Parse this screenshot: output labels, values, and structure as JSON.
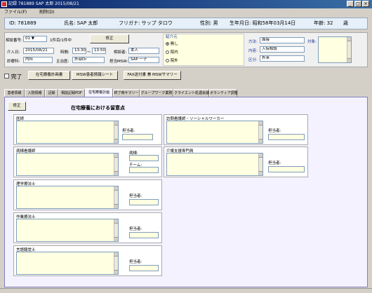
{
  "window": {
    "title": "記録 781889 SAP 太郎 2015/08/21"
  },
  "menu": {
    "items": [
      "ファイル(F)",
      "削除(D)"
    ]
  },
  "patient": {
    "id_text": "ID: 781889",
    "name_text": "氏名: SAP 太郎",
    "kana_text": "フリガナ: サップ タロウ",
    "sex_text": "性別: 男",
    "birth_text": "生年月日: 昭和58年03月14日",
    "age_text": "年齢: 32",
    "age_unit": "歳"
  },
  "form": {
    "count_label": "相談番号:",
    "count_value": "01",
    "count_suffix": "1件目/1件中",
    "edit_label": "修正",
    "admit_label": "介入日:",
    "admit_value": "2015/08/21",
    "time_label": "時間:",
    "time_from": "13:30",
    "time_sep": "～",
    "time_to": "13:50",
    "consultant_label": "相談者:",
    "consultant_value": "本人",
    "doctor_label": "診療科:",
    "doctor_value": "内科",
    "main_doc_label": "主治医:",
    "main_doc_value": "外部Dr",
    "msw_label": "担当MSW:",
    "msw_value": "SAP 一子",
    "referral_label": "紹介元",
    "referral_options": [
      "無し",
      "院内",
      "院外"
    ],
    "method_label": "方法:",
    "method_value": "面接",
    "content_label": "内容:",
    "content_value": "入院相談",
    "category_label": "区分:",
    "category_value": "外来",
    "target_label": "対象:"
  },
  "actions": {
    "complete_label": "完了",
    "btn_plan": "在宅療養計画書",
    "btn_msw_info": "MSW患者情報シート",
    "btn_fax": "FAX送付書 兼 MSWサマリー"
  },
  "tabs": [
    "患者情報",
    "入院情報",
    "記録",
    "相談記録PDF",
    "在宅療養計画",
    "終了時サマリー",
    "グループワーク業務",
    "クライエント処遇会議",
    "ボランティア調整"
  ],
  "panel": {
    "edit_label": "修正",
    "heading": "在宅療養における留意点",
    "staff_label": "担当者:",
    "nurse_staff_label": "病棟:",
    "team_label": "チーム:",
    "sections": {
      "doctor": "医師",
      "ward_nurse": "病棟看護師",
      "pt": "理学療法士",
      "ot": "作業療法士",
      "st": "言語聴覚士",
      "visit_nurse": "訪問看護師・ソーシャルワーカー",
      "care_support": "介護支援専門員"
    }
  }
}
